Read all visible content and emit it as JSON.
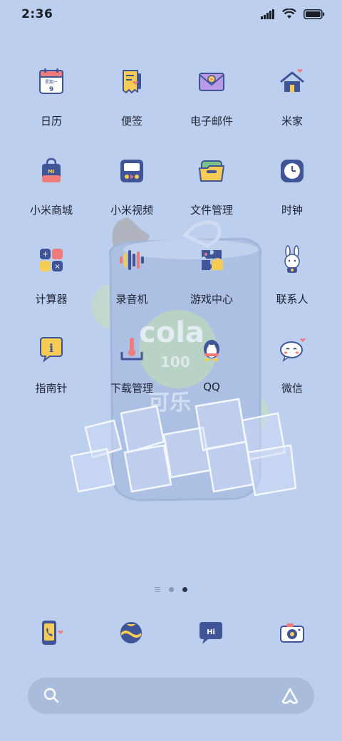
{
  "status_bar": {
    "time": "2:36",
    "icons": [
      "signal-icon",
      "wifi-icon",
      "battery-icon"
    ]
  },
  "apps": [
    {
      "label": "日历",
      "icon": "calendar-icon",
      "icon_text": "星期一",
      "icon_num": "9"
    },
    {
      "label": "便签",
      "icon": "notes-icon"
    },
    {
      "label": "电子邮件",
      "icon": "email-icon"
    },
    {
      "label": "米家",
      "icon": "home-icon"
    },
    {
      "label": "小米商城",
      "icon": "shopping-bag-icon",
      "icon_text": "MI"
    },
    {
      "label": "小米视频",
      "icon": "video-icon"
    },
    {
      "label": "文件管理",
      "icon": "folder-icon"
    },
    {
      "label": "时钟",
      "icon": "clock-icon"
    },
    {
      "label": "计算器",
      "icon": "calculator-icon"
    },
    {
      "label": "录音机",
      "icon": "recorder-icon"
    },
    {
      "label": "游戏中心",
      "icon": "game-center-icon"
    },
    {
      "label": "联系人",
      "icon": "contacts-rabbit-icon"
    },
    {
      "label": "指南针",
      "icon": "compass-icon"
    },
    {
      "label": "下载管理",
      "icon": "download-icon"
    },
    {
      "label": "QQ",
      "icon": "qq-penguin-icon"
    },
    {
      "label": "微信",
      "icon": "wechat-icon"
    }
  ],
  "wallpaper": {
    "can_text": "cola",
    "can_number": "100",
    "can_chinese": "可乐"
  },
  "pager": {
    "pages": 3,
    "active_index": 2
  },
  "dock": [
    {
      "icon": "phone-icon"
    },
    {
      "icon": "browser-globe-icon"
    },
    {
      "icon": "messages-icon",
      "icon_text": "Hi"
    },
    {
      "icon": "camera-icon"
    }
  ],
  "colors": {
    "background": "#bccfee",
    "icon_navy": "#3f5597",
    "icon_yellow": "#f6cc55",
    "icon_pink": "#ef7b7b"
  }
}
